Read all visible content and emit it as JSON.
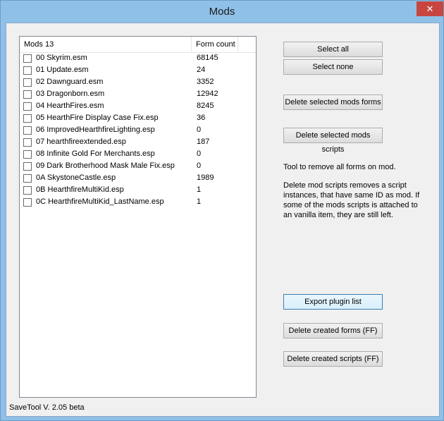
{
  "window": {
    "title": "Mods",
    "close_glyph": "✕"
  },
  "list": {
    "columns": [
      "Mods 13",
      "Form count"
    ],
    "rows": [
      {
        "name": "00 Skyrim.esm",
        "count": "68145"
      },
      {
        "name": "01 Update.esm",
        "count": "24"
      },
      {
        "name": "02 Dawnguard.esm",
        "count": "3352"
      },
      {
        "name": "03 Dragonborn.esm",
        "count": "12942"
      },
      {
        "name": "04 HearthFires.esm",
        "count": "8245"
      },
      {
        "name": "05 HearthFire Display Case Fix.esp",
        "count": "36"
      },
      {
        "name": "06 ImprovedHearthfireLighting.esp",
        "count": "0"
      },
      {
        "name": "07 hearthfireextended.esp",
        "count": "187"
      },
      {
        "name": "08 Infinite Gold For Merchants.esp",
        "count": "0"
      },
      {
        "name": "09 Dark Brotherhood Mask Male Fix.esp",
        "count": "0"
      },
      {
        "name": "0A SkystoneCastle.esp",
        "count": "1989"
      },
      {
        "name": "0B HearthfireMultiKid.esp",
        "count": "1"
      },
      {
        "name": "0C HearthfireMultiKid_LastName.esp",
        "count": "1"
      }
    ]
  },
  "buttons": {
    "select_all": "Select all",
    "select_none": "Select none",
    "delete_forms": "Delete selected mods forms",
    "delete_scripts": "Delete selected mods scripts",
    "export": "Export plugin list",
    "delete_created_forms": "Delete created forms (FF)",
    "delete_created_scripts": "Delete created scripts (FF)"
  },
  "text": {
    "desc1": "Tool to remove all forms on mod.",
    "desc2": "Delete mod scripts removes a script instances, that have same ID as mod. If some of the mods scripts is attached to an vanilla item, they are still left."
  },
  "status": "SaveTool V. 2.05 beta"
}
